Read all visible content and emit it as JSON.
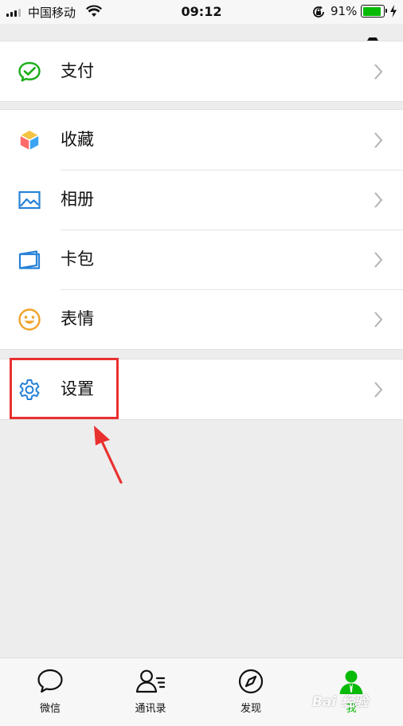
{
  "status_bar": {
    "carrier": "中国移动",
    "time": "09:12",
    "battery": "91%",
    "battery_level": 0.91
  },
  "groups": [
    {
      "items": [
        {
          "label": "支付",
          "icon": "wechat-pay-icon"
        }
      ]
    },
    {
      "items": [
        {
          "label": "收藏",
          "icon": "favorites-cube-icon"
        },
        {
          "label": "相册",
          "icon": "album-icon"
        },
        {
          "label": "卡包",
          "icon": "card-wallet-icon"
        },
        {
          "label": "表情",
          "icon": "sticker-smile-icon"
        }
      ]
    },
    {
      "items": [
        {
          "label": "设置",
          "icon": "gear-icon"
        }
      ]
    }
  ],
  "tabbar": {
    "tabs": [
      {
        "label": "微信",
        "icon": "chat-bubble-icon",
        "active": false
      },
      {
        "label": "通讯录",
        "icon": "contacts-icon",
        "active": false
      },
      {
        "label": "发现",
        "icon": "compass-icon",
        "active": false
      },
      {
        "label": "我",
        "icon": "me-person-icon",
        "active": true
      }
    ]
  },
  "watermark": "Bai 经验",
  "colors": {
    "accent_green": "#09bb07",
    "highlight_red": "#e8312f",
    "background": "#ededed"
  }
}
